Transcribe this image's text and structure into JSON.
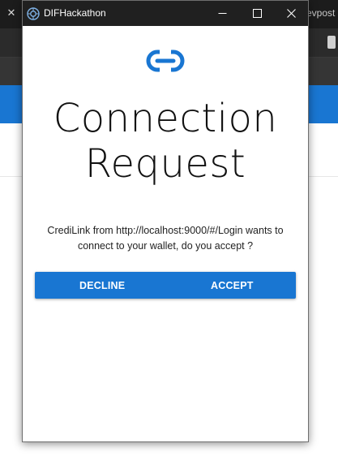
{
  "background_window": {
    "tab_close_glyph": "✕",
    "tab_partial_text": "evpost"
  },
  "popup": {
    "window_title": "DIFHackathon",
    "window_controls": {
      "minimize_icon": "minimize-icon",
      "maximize_icon": "maximize-icon",
      "close_icon": "close-icon"
    },
    "icon": "link-icon",
    "heading_line1": "Connection",
    "heading_line2": "Request",
    "message_line1": "CrediLink from http://localhost:9000/#/Login wants to",
    "message_line2": "connect to your wallet, do you accept ?",
    "decline_label": "DECLINE",
    "accept_label": "ACCEPT"
  },
  "colors": {
    "primary_blue": "#1976d2",
    "titlebar_dark": "#202020",
    "heading_text": "#111111"
  }
}
